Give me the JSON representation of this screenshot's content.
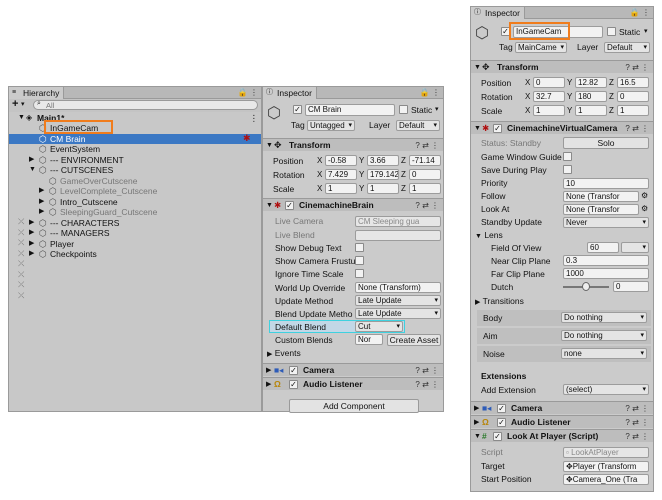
{
  "hierarchy": {
    "tab": "Hierarchy",
    "add": "+",
    "search_placeholder": "All",
    "scene": "Main1*",
    "items": [
      {
        "label": "InGameCam",
        "indent": 2,
        "muted": false,
        "selected": false,
        "arrow": ""
      },
      {
        "label": "CM Brain",
        "indent": 2,
        "muted": false,
        "selected": true,
        "arrow": ""
      },
      {
        "label": "EventSystem",
        "indent": 2,
        "muted": false,
        "selected": false,
        "arrow": ""
      },
      {
        "label": "--- ENVIRONMENT",
        "indent": 2,
        "muted": false,
        "selected": false,
        "arrow": "▶"
      },
      {
        "label": "--- CUTSCENES",
        "indent": 2,
        "muted": false,
        "selected": false,
        "arrow": "▼"
      },
      {
        "label": "GameOverCutscene",
        "indent": 3,
        "muted": true,
        "selected": false,
        "arrow": ""
      },
      {
        "label": "LevelComplete_Cutscene",
        "indent": 3,
        "muted": true,
        "selected": false,
        "arrow": "▶"
      },
      {
        "label": "Intro_Cutscene",
        "indent": 3,
        "muted": false,
        "selected": false,
        "arrow": "▶"
      },
      {
        "label": "SleepingGuard_Cutscene",
        "indent": 3,
        "muted": true,
        "selected": false,
        "arrow": "▶"
      },
      {
        "label": "--- CHARACTERS",
        "indent": 2,
        "muted": false,
        "selected": false,
        "arrow": "▶"
      },
      {
        "label": "--- MANAGERS",
        "indent": 2,
        "muted": false,
        "selected": false,
        "arrow": "▶"
      },
      {
        "label": "Player",
        "indent": 2,
        "muted": false,
        "selected": false,
        "arrow": "▶"
      },
      {
        "label": "Checkpoints",
        "indent": 2,
        "muted": false,
        "selected": false,
        "arrow": "▶"
      }
    ]
  },
  "insp1": {
    "tab": "Inspector",
    "name": "CM Brain",
    "static": "Static",
    "tag_label": "Tag",
    "tag": "Untagged",
    "layer_label": "Layer",
    "layer": "Default",
    "transform": {
      "title": "Transform",
      "rows": [
        {
          "label": "Position",
          "x": "-0.58",
          "y": "3.66",
          "z": "-71.14"
        },
        {
          "label": "Rotation",
          "x": "7.429",
          "y": "179.142",
          "z": "0"
        },
        {
          "label": "Scale",
          "x": "1",
          "y": "1",
          "z": "1"
        }
      ]
    },
    "brain": {
      "title": "CinemachineBrain",
      "live_camera_label": "Live Camera",
      "live_camera": "CM Sleeping gua",
      "live_blend_label": "Live Blend",
      "show_debug": "Show Debug Text",
      "show_frustum": "Show Camera Frustu",
      "ignore_timescale": "Ignore Time Scale",
      "world_up_label": "World Up Override",
      "world_up": "None (Transform)",
      "update_method_label": "Update Method",
      "update_method": "Late Update",
      "blend_update_label": "Blend Update Metho",
      "blend_update": "Late Update",
      "default_blend_label": "Default Blend",
      "default_blend": "Cut",
      "custom_blends_label": "Custom Blends",
      "custom_blends": "Nor",
      "create_asset": "Create Asset",
      "events": "Events"
    },
    "camera": "Camera",
    "audio": "Audio Listener",
    "add_component": "Add Component"
  },
  "insp2": {
    "tab": "Inspector",
    "name": "InGameCam",
    "static": "Static",
    "tag_label": "Tag",
    "tag": "MainCame",
    "layer_label": "Layer",
    "layer": "Default",
    "transform": {
      "title": "Transform",
      "rows": [
        {
          "label": "Position",
          "x": "0",
          "y": "12.82",
          "z": "16.5"
        },
        {
          "label": "Rotation",
          "x": "32.7",
          "y": "180",
          "z": "0"
        },
        {
          "label": "Scale",
          "x": "1",
          "y": "1",
          "z": "1"
        }
      ]
    },
    "vcam": {
      "title": "CinemachineVirtualCamera",
      "status_label": "Status: Standby",
      "solo": "Solo",
      "game_window_guide": "Game Window Guide",
      "save_during_play": "Save During Play",
      "priority_label": "Priority",
      "priority": "10",
      "follow_label": "Follow",
      "follow": "None (Transfor",
      "look_at_label": "Look At",
      "look_at": "None (Transfor",
      "standby_label": "Standby Update",
      "standby": "Never",
      "lens": "Lens",
      "fov_label": "Field Of View",
      "fov": "60",
      "near_label": "Near Clip Plane",
      "near": "0.3",
      "far_label": "Far Clip Plane",
      "far": "1000",
      "dutch_label": "Dutch",
      "dutch": "0",
      "transitions": "Transitions",
      "body_label": "Body",
      "body": "Do nothing",
      "aim_label": "Aim",
      "aim": "Do nothing",
      "noise_label": "Noise",
      "noise": "none",
      "extensions": "Extensions",
      "add_ext_label": "Add Extension",
      "add_ext": "(select)"
    },
    "camera": "Camera",
    "audio": "Audio Listener",
    "lookat": {
      "title": "Look At Player (Script)",
      "script_label": "Script",
      "script": "LookAtPlayer",
      "target_label": "Target",
      "target": "Player (Transform",
      "start_label": "Start Position",
      "start": "Camera_One (Tra"
    }
  }
}
